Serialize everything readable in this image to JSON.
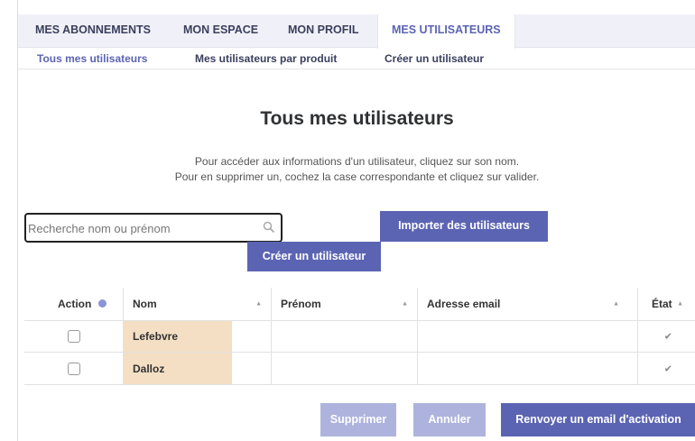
{
  "main_tabs": [
    "MES ABONNEMENTS",
    "MON ESPACE",
    "MON PROFIL",
    "MES UTILISATEURS"
  ],
  "sub_tabs": [
    "Tous mes utilisateurs",
    "Mes utilisateurs par produit",
    "Créer un utilisateur"
  ],
  "title": "Tous mes utilisateurs",
  "description": [
    "Pour accéder aux informations d'un utilisateur, cliquez sur son nom.",
    "Pour en supprimer un, cochez la case correspondante et cliquez sur valider."
  ],
  "search": {
    "placeholder": "Recherche nom ou prénom",
    "value": ""
  },
  "buttons": {
    "import": "Importer des utilisateurs",
    "create": "Créer un utilisateur",
    "delete": "Supprimer",
    "cancel": "Annuler",
    "resend": "Renvoyer un email d'activation"
  },
  "table": {
    "headers": {
      "action": "Action",
      "nom": "Nom",
      "prenom": "Prénom",
      "email": "Adresse email",
      "etat": "État"
    },
    "rows": [
      {
        "nom": "Lefebvre",
        "prenom": "",
        "email": "",
        "etat": "✔"
      },
      {
        "nom": "Dalloz",
        "prenom": "",
        "email": "",
        "etat": "✔"
      }
    ]
  },
  "colors": {
    "accent": "#5b64b3",
    "accent_disabled": "#aeb3dd",
    "highlight": "#f5dfc4",
    "tab_bg": "#f0f1f8"
  }
}
